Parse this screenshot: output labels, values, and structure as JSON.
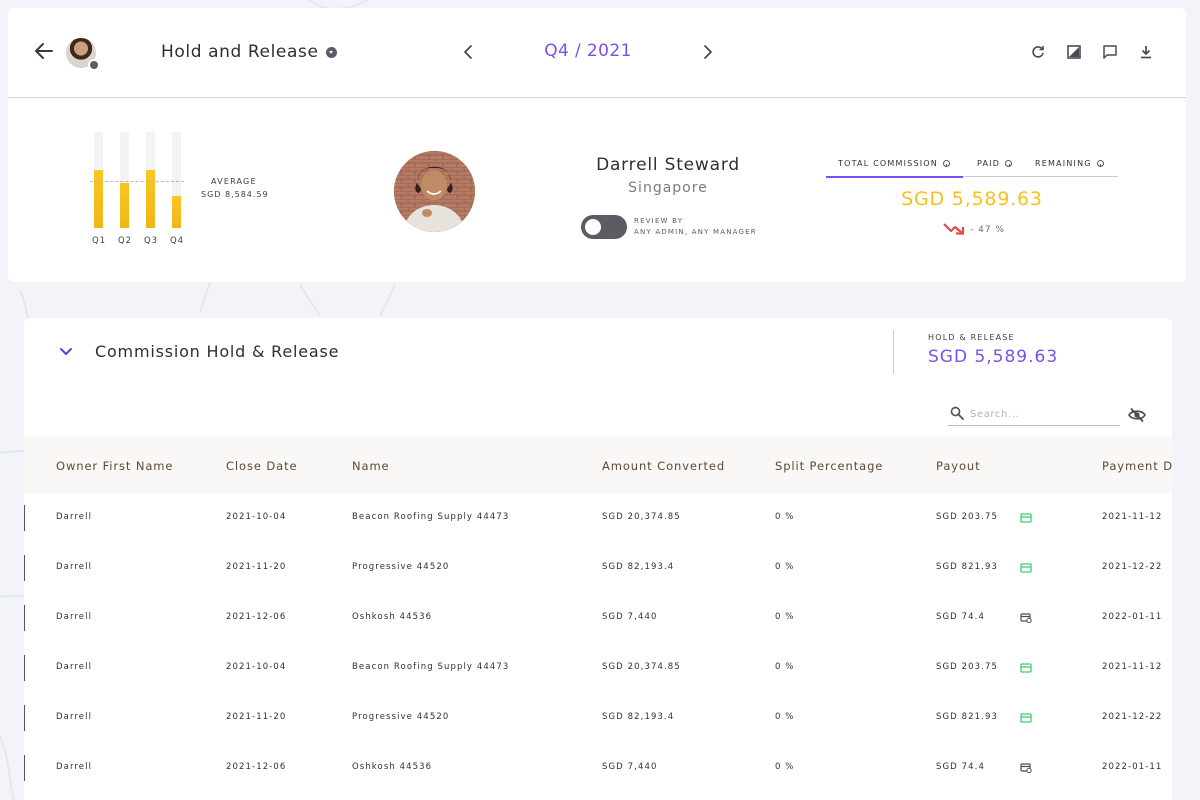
{
  "header": {
    "title": "Hold and Release",
    "period": "Q4 / 2021",
    "tools": [
      "refresh-icon",
      "image-icon",
      "comment-icon",
      "download-icon"
    ]
  },
  "summary": {
    "chart_data": {
      "type": "bar",
      "categories": [
        "Q1",
        "Q2",
        "Q3",
        "Q4"
      ],
      "values": [
        9000,
        7000,
        9000,
        5000
      ],
      "ylim": [
        0,
        15000
      ],
      "average": 8584.59,
      "average_title": "AVERAGE",
      "average_label": "SGD 8,584.59",
      "bar_color": "#f8c722"
    },
    "person": {
      "name": "Darrell Steward",
      "location": "Singapore"
    },
    "review": {
      "label": "REVIEW BY",
      "value": "ANY ADMIN, ANY MANAGER",
      "enabled": false
    },
    "commission": {
      "tabs": [
        "TOTAL COMMISSION",
        "PAID",
        "REMAINING"
      ],
      "active_tab": "TOTAL COMMISSION",
      "amount": "SGD 5,589.63",
      "trend": "- 47 %",
      "trend_color": "#e14a4a",
      "amount_color": "#f7c11c"
    }
  },
  "section": {
    "title": "Commission Hold & Release",
    "hold_release_label": "HOLD & RELEASE",
    "hold_release_value": "SGD 5,589.63",
    "search_placeholder": "Search...",
    "accent": "#7b4ff1"
  },
  "table": {
    "columns": [
      "Owner First Name",
      "Close Date",
      "Name",
      "Amount Converted",
      "Split Percentage",
      "Payout",
      "Payment Date"
    ],
    "rows": [
      [
        "Darrell",
        "2021-10-04",
        "Beacon Roofing Supply 44473",
        "SGD 20,374.85",
        "0 %",
        "SGD 203.75",
        "2021-11-12"
      ],
      [
        "Darrell",
        "2021-11-20",
        "Progressive 44520",
        "SGD 82,193.4",
        "0 %",
        "SGD 821.93",
        "2021-12-22"
      ],
      [
        "Darrell",
        "2021-12-06",
        "Oshkosh 44536",
        "SGD 7,440",
        "0 %",
        "SGD 74.4",
        "2022-01-11"
      ],
      [
        "Darrell",
        "2021-10-04",
        "Beacon Roofing Supply 44473",
        "SGD 20,374.85",
        "0 %",
        "SGD 203.75",
        "2021-11-12"
      ],
      [
        "Darrell",
        "2021-11-20",
        "Progressive 44520",
        "SGD 82,193.4",
        "0 %",
        "SGD 821.93",
        "2021-12-22"
      ],
      [
        "Darrell",
        "2021-12-06",
        "Oshkosh 44536",
        "SGD 7,440",
        "0 %",
        "SGD 74.4",
        "2022-01-11"
      ]
    ],
    "payout_icons": [
      "card-paid-icon",
      "card-paid-icon",
      "card-pending-icon",
      "card-paid-icon",
      "card-paid-icon",
      "card-pending-icon"
    ]
  }
}
